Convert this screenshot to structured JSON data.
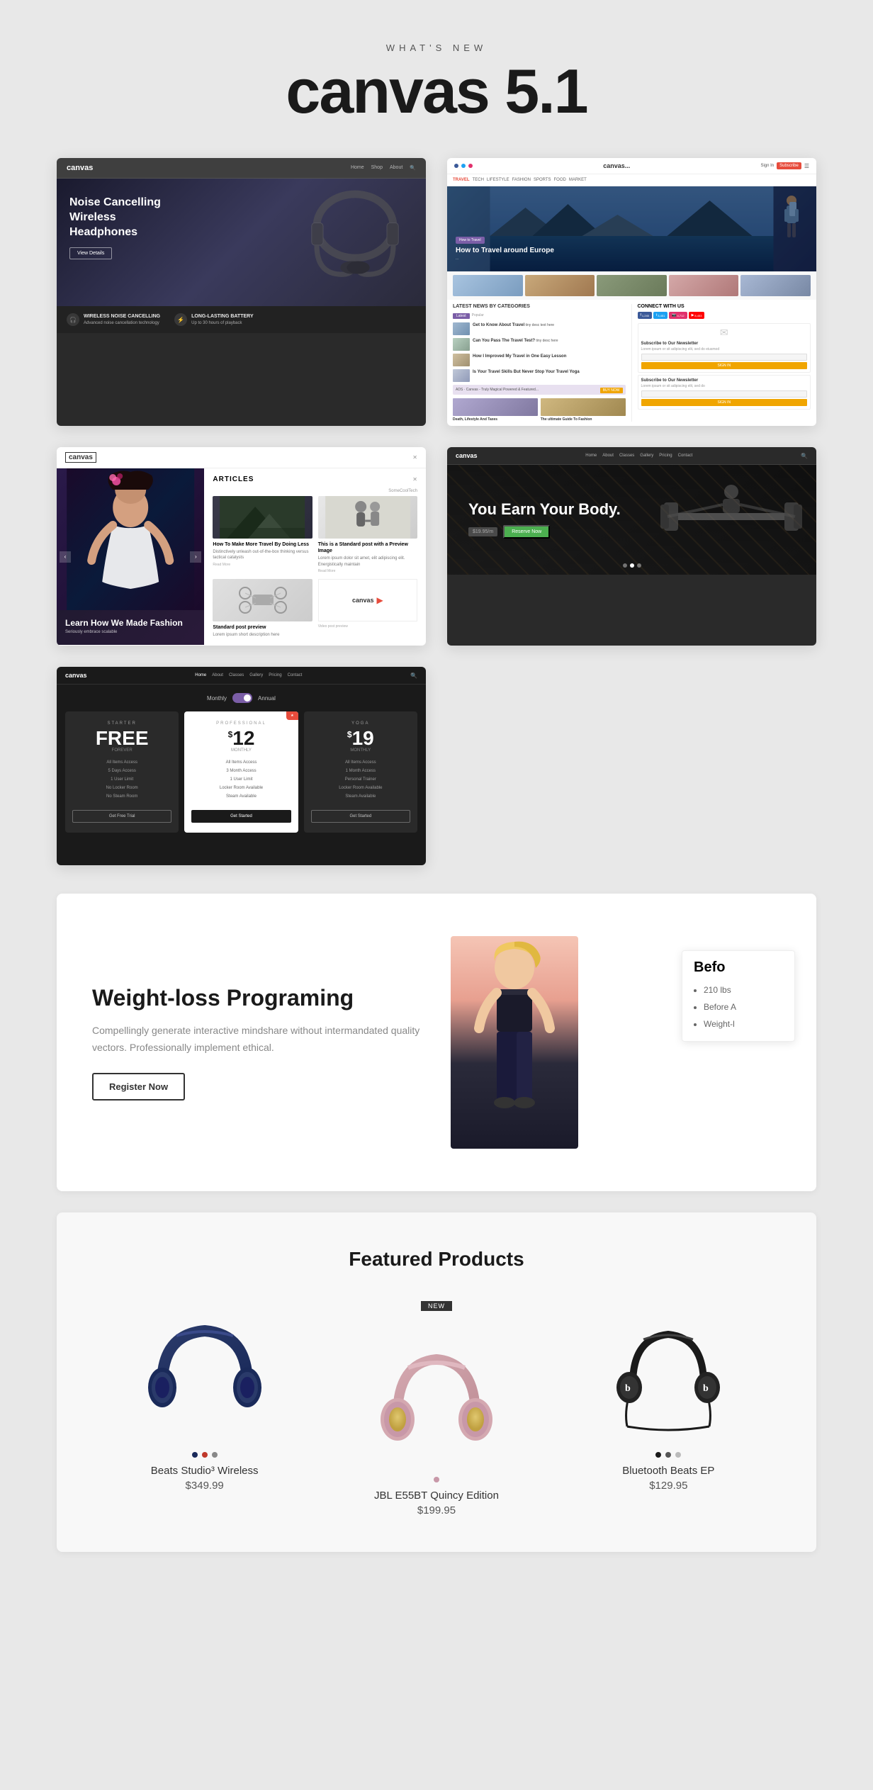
{
  "header": {
    "subtitle": "WHAT'S NEW",
    "title": "canvas 5.1"
  },
  "screenshots": {
    "ss1": {
      "logo": "canvas",
      "hero_text": "Noise Cancelling Wireless Headphones",
      "cta": "View Details",
      "feature1_title": "WIRELESS NOISE CANCELLING",
      "feature2_title": "LONG-LASTING BATTERY"
    },
    "ss2": {
      "logo": "canvas...",
      "hero_tag": "How to Travel",
      "hero_title": "How to Travel around Europe",
      "section_title": "LATEST NEWS BY CATEGORIES",
      "sidebar_title": "CONNECT WITH US",
      "subscribe_title": "Subscribe to Our Newsletter",
      "subscribe_cta": "SIGN IN",
      "article1_title": "How I Improved My Travel in One Easy Lesson",
      "article2_title": "Is Your Travel Skills But Never Stop Your Travel Yoga"
    },
    "ss3": {
      "logo": "canvas",
      "section_title": "ARTICLES",
      "slider_title": "Learn How We Made Fashion",
      "slider_subtitle": "Seriously embrace scalable",
      "article1_title": "How To Make More Travel By Doing Less",
      "article1_text": "Distinctively unleash out-of-the-box thinking versus tactical catalysts",
      "article2_title": "This is a Standard post with a Preview Image",
      "article2_text": "Lorem ipsum dolor sit amet, elit adipiscing elit. Energistically maintain",
      "video_icon": "▶"
    },
    "ss4": {
      "logo": "canvas",
      "nav": [
        "Home",
        "About",
        "Classes",
        "Gallery",
        "Pricing",
        "Contact"
      ],
      "toggle_monthly": "Monthly",
      "toggle_annual": "Annual",
      "plan1_name": "STARTER",
      "plan1_price": "FREE",
      "plan1_period": "FOREVER",
      "plan1_features": [
        "All Items Access",
        "5 Days Access",
        "1 User Limit",
        "No Locker Room",
        "No Steam Room"
      ],
      "plan1_cta": "Get Free Trial",
      "plan2_name": "PROFESSIONAL",
      "plan2_price": "12",
      "plan2_period": "MONTHLY",
      "plan2_features": [
        "All Items Access",
        "3 Month Access",
        "1 User Limit",
        "Locker Room Available",
        "Steam Available"
      ],
      "plan2_cta": "Get Started",
      "plan3_name": "YOGA",
      "plan3_price": "19",
      "plan3_period": "MONTHLY",
      "plan3_features": [
        "All Items Access",
        "1 Month Access",
        "Personal Trainer",
        "Locker Room Available",
        "Steam Available"
      ],
      "plan3_cta": "Get Started",
      "featured_badge": "★"
    },
    "ss5": {
      "logo": "canvas",
      "nav": [
        "Home",
        "About",
        "Classes",
        "Gallery",
        "Pricing",
        "Contact"
      ],
      "hero_title": "You Earn Your Body.",
      "price": "$19.95/m",
      "cta": "Reserve Now"
    }
  },
  "weight_loss": {
    "title": "Weight-loss Programing",
    "description": "Compellingly generate interactive mindshare without intermandated quality vectors. Professionally implement ethical.",
    "cta": "Register Now",
    "before_title": "Befo",
    "before_list": [
      "210 lbs",
      "Before A",
      "Weight-l"
    ]
  },
  "featured_products": {
    "title": "Featured Products",
    "badge": "NEW",
    "products": [
      {
        "name": "Beats Studio³ Wireless",
        "price": "$349.99",
        "colors": [
          "#1a2a4a",
          "#c0392b",
          "#888"
        ]
      },
      {
        "name": "JBL E55BT Quincy Edition",
        "price": "$199.95",
        "colors": [
          "#c8a0b0"
        ]
      },
      {
        "name": "Bluetooth Beats EP",
        "price": "$129.95",
        "colors": [
          "#1a1a1a",
          "#555",
          "#aaa"
        ]
      }
    ]
  }
}
